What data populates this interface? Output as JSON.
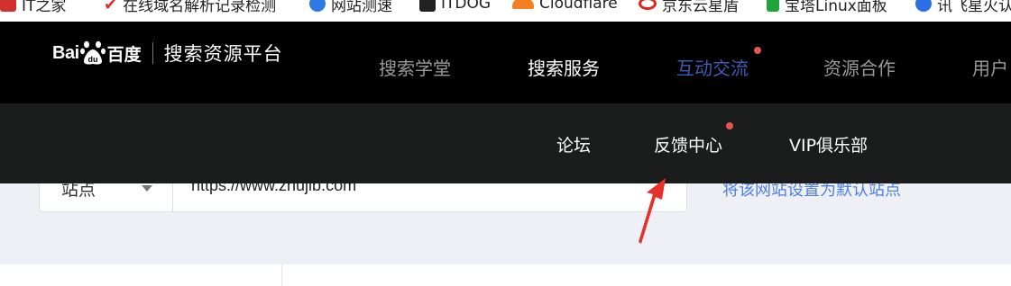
{
  "bookmarks": [
    {
      "label": "IT之家",
      "icon": "ithome-icon",
      "color": "#d0312d"
    },
    {
      "label": "在线域名解析记录检测",
      "icon": "check-icon",
      "color": "#e0302d"
    },
    {
      "label": "网站测速",
      "icon": "speedtest-icon",
      "color": "#2e78e6"
    },
    {
      "label": "ITDOG",
      "icon": "itdog-icon",
      "color": "#222222"
    },
    {
      "label": "Cloudflare",
      "icon": "cloudflare-icon",
      "color": "#f38020"
    },
    {
      "label": "京东云星盾",
      "icon": "jdcloud-icon",
      "color": "#e1251b"
    },
    {
      "label": "宝塔Linux面板",
      "icon": "bt-icon",
      "color": "#20a53a"
    },
    {
      "label": "讯飞星火认",
      "icon": "xunfei-icon",
      "color": "#2b6de5"
    }
  ],
  "header": {
    "logo_text": "Bai",
    "logo_du": "du",
    "logo_cn": "百度",
    "platform": "搜索资源平台",
    "nav": [
      {
        "label": "搜索学堂"
      },
      {
        "label": "搜索服务"
      },
      {
        "label": "互动交流"
      },
      {
        "label": "资源合作"
      },
      {
        "label": "用户"
      }
    ]
  },
  "subnav": [
    {
      "label": "论坛"
    },
    {
      "label": "反馈中心"
    },
    {
      "label": "VIP俱乐部"
    }
  ],
  "site_form": {
    "select_label": "站点",
    "url_value": "https://www.zhujib.com",
    "default_link": "将该网站设置为默认站点"
  },
  "colors": {
    "topnav_bg": "#000000",
    "subnav_bg": "#1b1c1c",
    "nav_hover": "#3e5cb8",
    "notify_dot": "#e8554e",
    "arrow": "#e8302a",
    "link": "#4e7fe0"
  }
}
